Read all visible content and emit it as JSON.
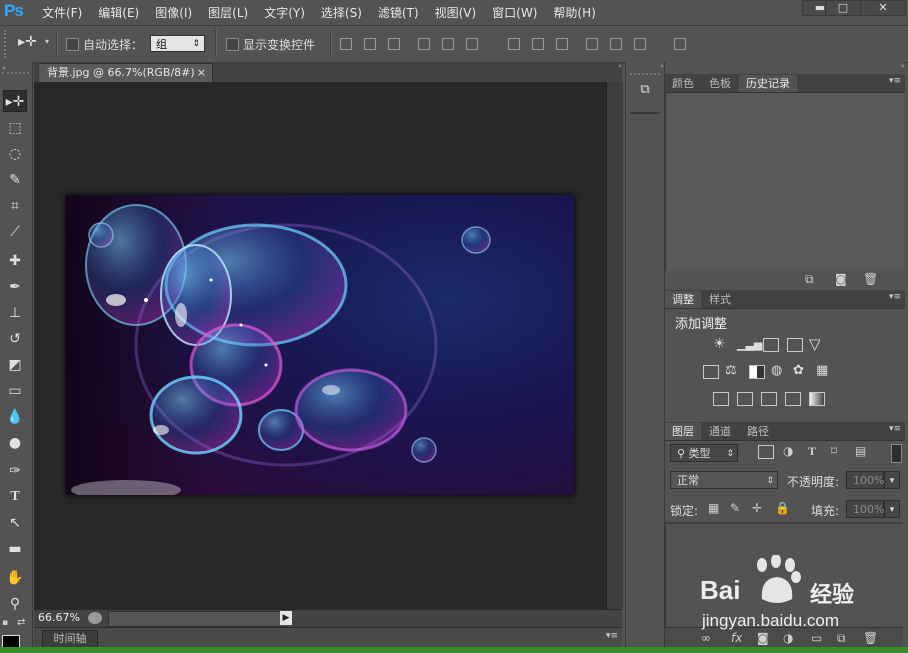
{
  "app": {
    "logo": "Ps"
  },
  "menu": [
    "文件(F)",
    "编辑(E)",
    "图像(I)",
    "图层(L)",
    "文字(Y)",
    "选择(S)",
    "滤镜(T)",
    "视图(V)",
    "窗口(W)",
    "帮助(H)"
  ],
  "window_controls": {
    "minimize": "▬",
    "maximize": "□",
    "close": "✕"
  },
  "options": {
    "auto_select_label": "自动选择：",
    "auto_select_value": "组",
    "show_transform_label": "显示变换控件"
  },
  "document": {
    "tab_title": "背景.jpg @ 66.7%(RGB/8#)",
    "tab_close": "×",
    "zoom": "66.67%"
  },
  "timeline": {
    "label": "时间轴"
  },
  "panels": {
    "top_tabs": [
      "颜色",
      "色板",
      "历史记录"
    ],
    "adjust_tabs": [
      "调整",
      "样式"
    ],
    "adjust_title": "添加调整",
    "layers_tabs": [
      "图层",
      "通道",
      "路径"
    ],
    "kind_label": "类型",
    "blend_mode": "正常",
    "opacity_label": "不透明度:",
    "opacity_value": "100%",
    "lock_label": "锁定:",
    "fill_label": "填充:",
    "fill_value": "100%"
  },
  "watermark": {
    "brand": "Bai",
    "brand2": "经验",
    "url": "jingyan.baidu.com"
  },
  "colors": {
    "accent_blue": "#31a8ff",
    "panel_bg": "#535353",
    "canvas_bg": "#282828"
  }
}
